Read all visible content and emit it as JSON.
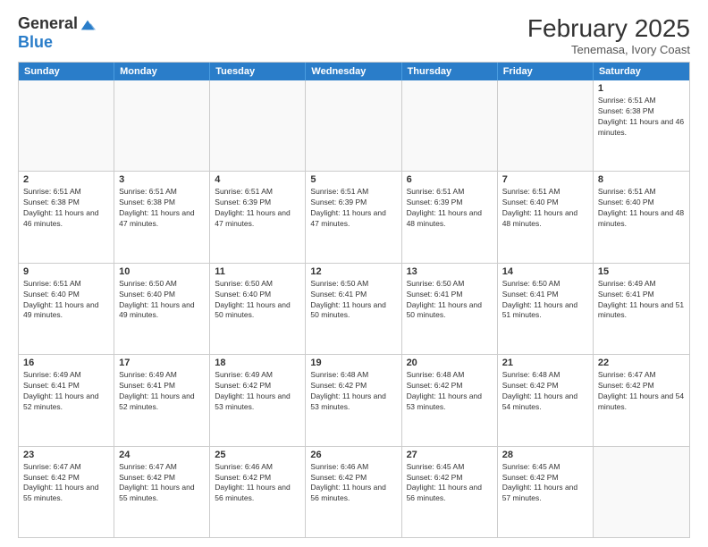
{
  "header": {
    "logo_general": "General",
    "logo_blue": "Blue",
    "month_title": "February 2025",
    "subtitle": "Tenemasa, Ivory Coast"
  },
  "weekdays": [
    "Sunday",
    "Monday",
    "Tuesday",
    "Wednesday",
    "Thursday",
    "Friday",
    "Saturday"
  ],
  "weeks": [
    [
      {
        "day": "",
        "info": ""
      },
      {
        "day": "",
        "info": ""
      },
      {
        "day": "",
        "info": ""
      },
      {
        "day": "",
        "info": ""
      },
      {
        "day": "",
        "info": ""
      },
      {
        "day": "",
        "info": ""
      },
      {
        "day": "1",
        "info": "Sunrise: 6:51 AM\nSunset: 6:38 PM\nDaylight: 11 hours and 46 minutes."
      }
    ],
    [
      {
        "day": "2",
        "info": "Sunrise: 6:51 AM\nSunset: 6:38 PM\nDaylight: 11 hours and 46 minutes."
      },
      {
        "day": "3",
        "info": "Sunrise: 6:51 AM\nSunset: 6:38 PM\nDaylight: 11 hours and 47 minutes."
      },
      {
        "day": "4",
        "info": "Sunrise: 6:51 AM\nSunset: 6:39 PM\nDaylight: 11 hours and 47 minutes."
      },
      {
        "day": "5",
        "info": "Sunrise: 6:51 AM\nSunset: 6:39 PM\nDaylight: 11 hours and 47 minutes."
      },
      {
        "day": "6",
        "info": "Sunrise: 6:51 AM\nSunset: 6:39 PM\nDaylight: 11 hours and 48 minutes."
      },
      {
        "day": "7",
        "info": "Sunrise: 6:51 AM\nSunset: 6:40 PM\nDaylight: 11 hours and 48 minutes."
      },
      {
        "day": "8",
        "info": "Sunrise: 6:51 AM\nSunset: 6:40 PM\nDaylight: 11 hours and 48 minutes."
      }
    ],
    [
      {
        "day": "9",
        "info": "Sunrise: 6:51 AM\nSunset: 6:40 PM\nDaylight: 11 hours and 49 minutes."
      },
      {
        "day": "10",
        "info": "Sunrise: 6:50 AM\nSunset: 6:40 PM\nDaylight: 11 hours and 49 minutes."
      },
      {
        "day": "11",
        "info": "Sunrise: 6:50 AM\nSunset: 6:40 PM\nDaylight: 11 hours and 50 minutes."
      },
      {
        "day": "12",
        "info": "Sunrise: 6:50 AM\nSunset: 6:41 PM\nDaylight: 11 hours and 50 minutes."
      },
      {
        "day": "13",
        "info": "Sunrise: 6:50 AM\nSunset: 6:41 PM\nDaylight: 11 hours and 50 minutes."
      },
      {
        "day": "14",
        "info": "Sunrise: 6:50 AM\nSunset: 6:41 PM\nDaylight: 11 hours and 51 minutes."
      },
      {
        "day": "15",
        "info": "Sunrise: 6:49 AM\nSunset: 6:41 PM\nDaylight: 11 hours and 51 minutes."
      }
    ],
    [
      {
        "day": "16",
        "info": "Sunrise: 6:49 AM\nSunset: 6:41 PM\nDaylight: 11 hours and 52 minutes."
      },
      {
        "day": "17",
        "info": "Sunrise: 6:49 AM\nSunset: 6:41 PM\nDaylight: 11 hours and 52 minutes."
      },
      {
        "day": "18",
        "info": "Sunrise: 6:49 AM\nSunset: 6:42 PM\nDaylight: 11 hours and 53 minutes."
      },
      {
        "day": "19",
        "info": "Sunrise: 6:48 AM\nSunset: 6:42 PM\nDaylight: 11 hours and 53 minutes."
      },
      {
        "day": "20",
        "info": "Sunrise: 6:48 AM\nSunset: 6:42 PM\nDaylight: 11 hours and 53 minutes."
      },
      {
        "day": "21",
        "info": "Sunrise: 6:48 AM\nSunset: 6:42 PM\nDaylight: 11 hours and 54 minutes."
      },
      {
        "day": "22",
        "info": "Sunrise: 6:47 AM\nSunset: 6:42 PM\nDaylight: 11 hours and 54 minutes."
      }
    ],
    [
      {
        "day": "23",
        "info": "Sunrise: 6:47 AM\nSunset: 6:42 PM\nDaylight: 11 hours and 55 minutes."
      },
      {
        "day": "24",
        "info": "Sunrise: 6:47 AM\nSunset: 6:42 PM\nDaylight: 11 hours and 55 minutes."
      },
      {
        "day": "25",
        "info": "Sunrise: 6:46 AM\nSunset: 6:42 PM\nDaylight: 11 hours and 56 minutes."
      },
      {
        "day": "26",
        "info": "Sunrise: 6:46 AM\nSunset: 6:42 PM\nDaylight: 11 hours and 56 minutes."
      },
      {
        "day": "27",
        "info": "Sunrise: 6:45 AM\nSunset: 6:42 PM\nDaylight: 11 hours and 56 minutes."
      },
      {
        "day": "28",
        "info": "Sunrise: 6:45 AM\nSunset: 6:42 PM\nDaylight: 11 hours and 57 minutes."
      },
      {
        "day": "",
        "info": ""
      }
    ]
  ]
}
